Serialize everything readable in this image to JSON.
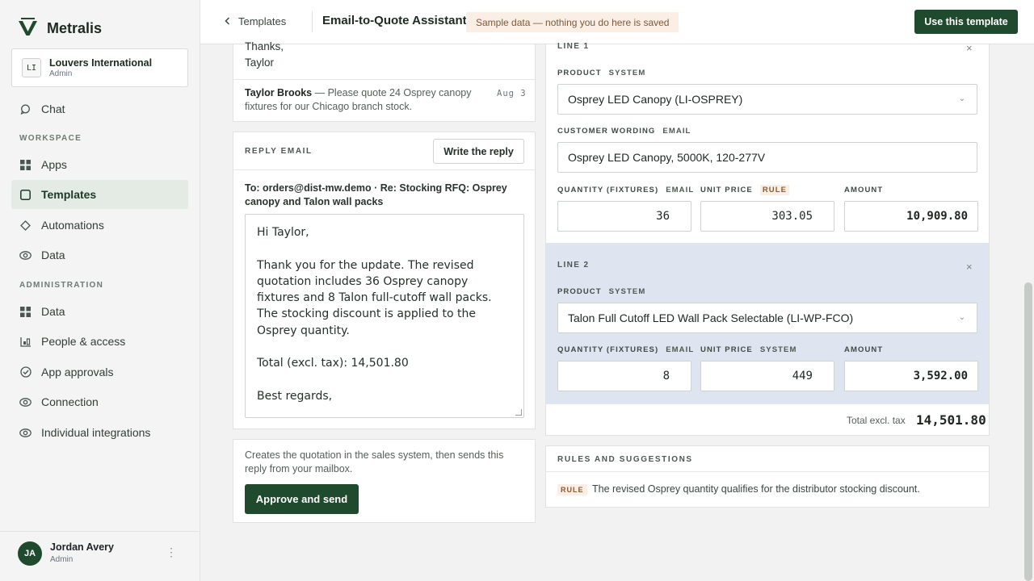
{
  "brand": {
    "name": "Metralis"
  },
  "org": {
    "badge": "LI",
    "name": "Louvers International",
    "role": "Admin"
  },
  "nav": {
    "chat": "Chat",
    "workspace_label": "WORKSPACE",
    "apps": "Apps",
    "templates": "Templates",
    "automations": "Automations",
    "data": "Data",
    "admin_label": "ADMINISTRATION",
    "admin_data": "Data",
    "people": "People & access",
    "app_approvals": "App approvals",
    "connection": "Connection",
    "integrations": "Individual integrations"
  },
  "user": {
    "initials": "JA",
    "name": "Jordan Avery",
    "role": "Admin"
  },
  "topbar": {
    "back_label": "Templates",
    "title": "Email-to-Quote Assistant",
    "sample_note": "Sample data — nothing you do here is saved",
    "use_button": "Use this template"
  },
  "thread": {
    "prev_closing": "Thanks,",
    "prev_signature": "Taylor",
    "msg_sender": "Taylor Brooks",
    "msg_preview": "— Please quote 24 Osprey canopy fixtures for our Chicago branch stock.",
    "msg_date": "Aug 3"
  },
  "reply": {
    "heading": "REPLY EMAIL",
    "write_button": "Write the reply",
    "to_line": "To: orders@dist-mw.demo · Re: Stocking RFQ: Osprey canopy and Talon wall packs",
    "body": "Hi Taylor,\n\nThank you for the update. The revised quotation includes 36 Osprey canopy fixtures and 8 Talon full-cutoff wall packs. The stocking discount is applied to the Osprey quantity.\n\nTotal (excl. tax): 14,501.80\n\nBest regards,"
  },
  "approve": {
    "description": "Creates the quotation in the sales system, then sends this reply from your mailbox.",
    "button": "Approve and send"
  },
  "labels": {
    "product": "PRODUCT",
    "customer_wording": "CUSTOMER WORDING",
    "quantity": "QUANTITY (FIXTURES)",
    "unit_price": "UNIT PRICE",
    "amount": "AMOUNT",
    "tag_system": "SYSTEM",
    "tag_email": "EMAIL",
    "tag_rule": "RULE"
  },
  "lines": [
    {
      "label": "LINE 1",
      "product": "Osprey LED Canopy (LI-OSPREY)",
      "customer_wording": "Osprey LED Canopy, 5000K, 120-277V",
      "quantity": "36",
      "unit_price": "303.05",
      "amount": "10,909.80"
    },
    {
      "label": "LINE 2",
      "product": "Talon Full Cutoff LED Wall Pack Selectable (LI-WP-FCO)",
      "quantity": "8",
      "unit_price": "449",
      "amount": "3,592.00"
    }
  ],
  "total": {
    "label": "Total excl. tax",
    "value": "14,501.80"
  },
  "rules": {
    "heading": "RULES AND SUGGESTIONS",
    "tag": "RULE",
    "text": "The revised Osprey quantity qualifies for the distributor stocking discount."
  },
  "colors": {
    "primary": "#1f4a2e",
    "highlight_line": "#dfe5f0",
    "rule_tag_bg": "#fbeee4"
  }
}
